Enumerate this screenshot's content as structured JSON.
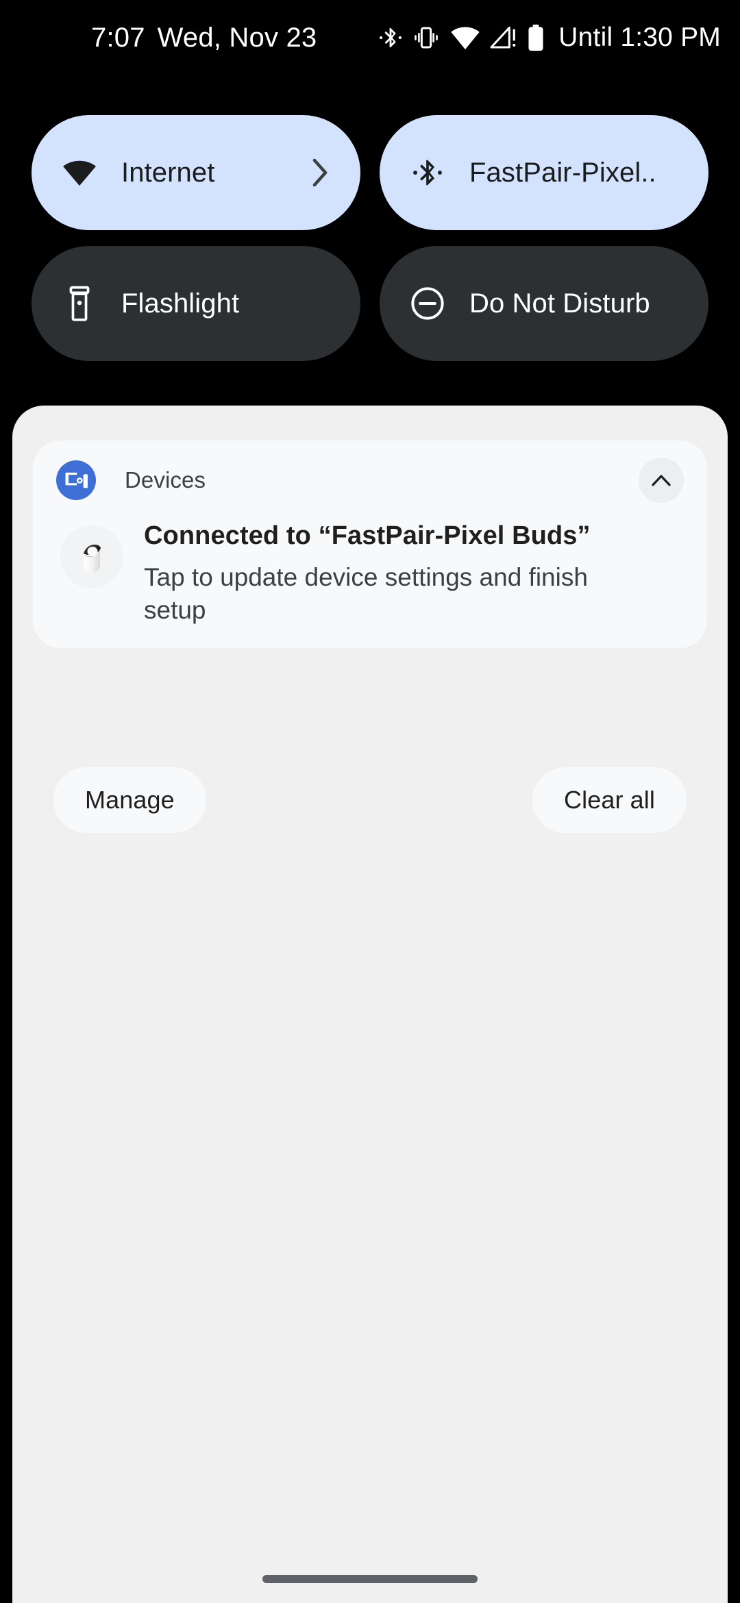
{
  "status_bar": {
    "clock": "7:07",
    "date": "Wed, Nov 23",
    "icons": [
      "bluetooth-icon",
      "vibrate-icon",
      "wifi-icon",
      "cellular-no-service-icon",
      "battery-icon"
    ],
    "battery_estimate": "Until 1:30 PM"
  },
  "quick_settings": {
    "tiles": [
      {
        "label": "Internet",
        "icon": "wifi-icon",
        "state": "active",
        "has_chevron": true
      },
      {
        "label": "FastPair-Pixel..",
        "icon": "bluetooth-icon",
        "state": "active",
        "has_chevron": false
      },
      {
        "label": "Flashlight",
        "icon": "flashlight-icon",
        "state": "inactive",
        "has_chevron": false
      },
      {
        "label": "Do Not Disturb",
        "icon": "do-not-disturb-icon",
        "state": "inactive",
        "has_chevron": false
      }
    ],
    "active_tile_color": "#d3e3fd",
    "inactive_tile_color": "#2d3033"
  },
  "notification_shade": {
    "background_color": "#f0f0f0",
    "notification": {
      "app_name": "Devices",
      "app_icon": "devices-icon",
      "app_icon_color": "#3d6fd6",
      "collapse_icon": "chevron-up-icon",
      "thumbnail": "pixel-buds-image",
      "title": "Connected to “FastPair-Pixel Buds”",
      "body": "Tap to update device settings and finish setup"
    },
    "actions": {
      "manage_label": "Manage",
      "clear_all_label": "Clear all"
    }
  },
  "navigation": {
    "home_indicator": "home-indicator"
  }
}
